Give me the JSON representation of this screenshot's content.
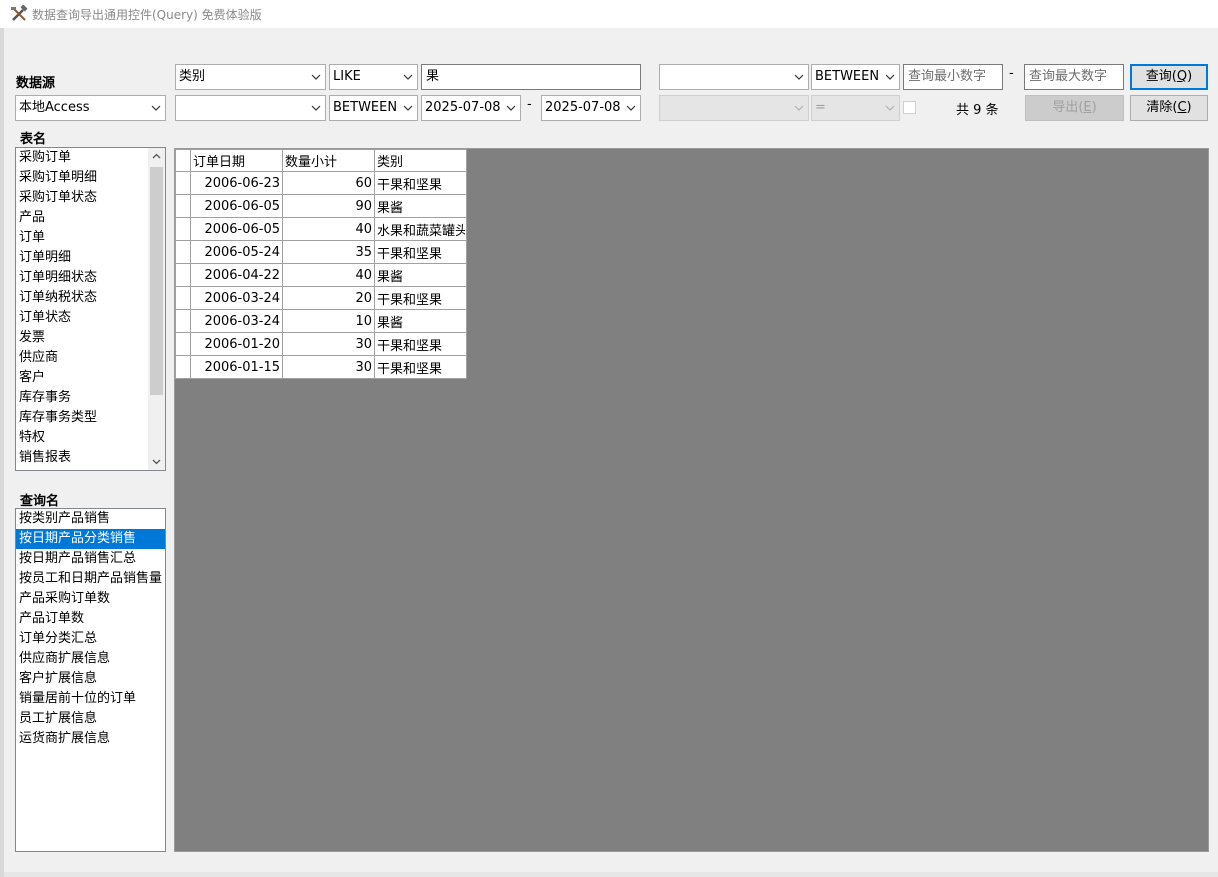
{
  "window": {
    "title": "数据查询导出通用控件(Query) 免费体验版"
  },
  "datasource": {
    "label": "数据源",
    "value": "本地Access"
  },
  "tables": {
    "label": "表名",
    "items": [
      "采购订单",
      "采购订单明细",
      "采购订单状态",
      "产品",
      "订单",
      "订单明细",
      "订单明细状态",
      "订单纳税状态",
      "订单状态",
      "发票",
      "供应商",
      "客户",
      "库存事务",
      "库存事务类型",
      "特权",
      "销售报表"
    ]
  },
  "queries": {
    "label": "查询名",
    "selected_index": 1,
    "items": [
      "按类别产品销售",
      "按日期产品分类销售",
      "按日期产品销售汇总",
      "按员工和日期产品销售量",
      "产品采购订单数",
      "产品订单数",
      "订单分类汇总",
      "供应商扩展信息",
      "客户扩展信息",
      "销量居前十位的订单",
      "员工扩展信息",
      "运货商扩展信息"
    ]
  },
  "filters": {
    "row1": {
      "field": "类别",
      "operator": "LIKE",
      "value": "果"
    },
    "row2": {
      "field": "",
      "operator": "BETWEEN",
      "from": "2025-07-08",
      "to": "2025-07-08",
      "dash": "-"
    },
    "row3": {
      "field": "",
      "operator": "BETWEEN",
      "min_placeholder": "查询最小数字",
      "max_placeholder": "查询最大数字",
      "dash": "-"
    },
    "row4": {
      "field": "",
      "operator": "="
    }
  },
  "buttons": {
    "query": {
      "label": "查询(",
      "key": "Q",
      "tail": ")"
    },
    "export": {
      "label": "导出(",
      "key": "E",
      "tail": ")"
    },
    "clear": {
      "label": "清除(",
      "key": "C",
      "tail": ")"
    }
  },
  "result_count": "共 9 条",
  "grid": {
    "columns": [
      "订单日期",
      "数量小计",
      "类别"
    ],
    "rows": [
      [
        "2006-06-23",
        "60",
        "干果和坚果"
      ],
      [
        "2006-06-05",
        "90",
        "果酱"
      ],
      [
        "2006-06-05",
        "40",
        "水果和蔬菜罐头"
      ],
      [
        "2006-05-24",
        "35",
        "干果和坚果"
      ],
      [
        "2006-04-22",
        "40",
        "果酱"
      ],
      [
        "2006-03-24",
        "20",
        "干果和坚果"
      ],
      [
        "2006-03-24",
        "10",
        "果酱"
      ],
      [
        "2006-01-20",
        "30",
        "干果和坚果"
      ],
      [
        "2006-01-15",
        "30",
        "干果和坚果"
      ]
    ]
  },
  "colors": {
    "selection": "#0078d7",
    "grid_background": "#808080",
    "window_background": "#f0f0f0"
  }
}
